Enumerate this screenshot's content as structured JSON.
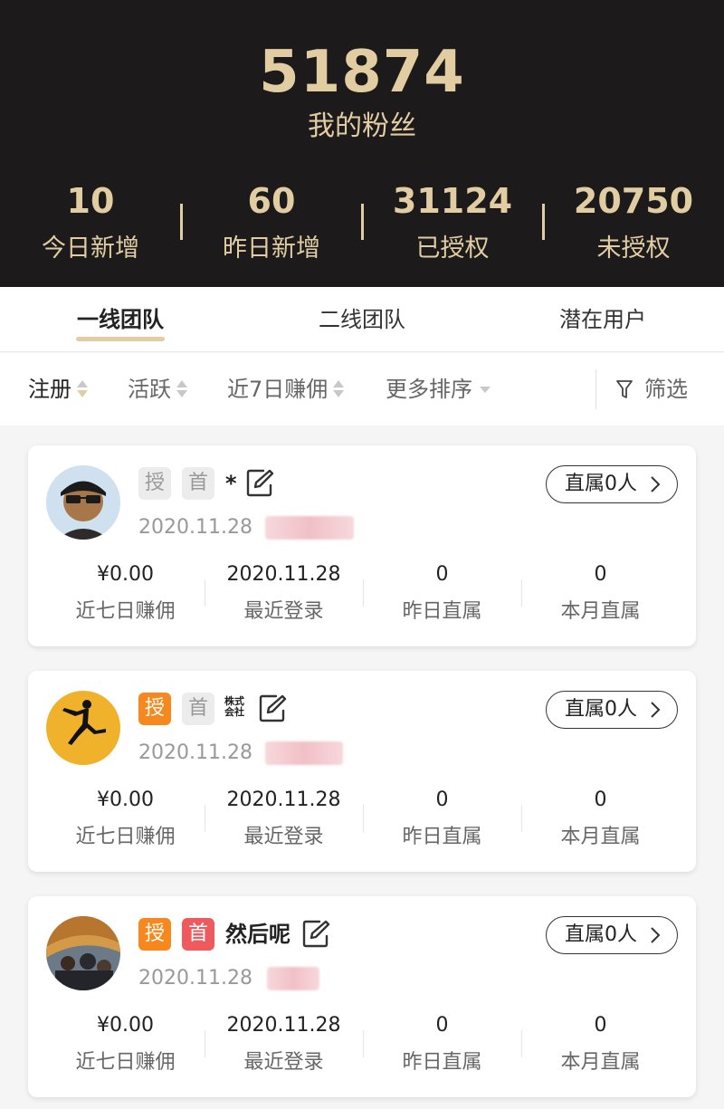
{
  "header": {
    "total_fans": "51874",
    "total_label": "我的粉丝",
    "stats": [
      {
        "value": "10",
        "label": "今日新增"
      },
      {
        "value": "60",
        "label": "昨日新增"
      },
      {
        "value": "31124",
        "label": "已授权"
      },
      {
        "value": "20750",
        "label": "未授权"
      }
    ]
  },
  "tabs": [
    {
      "label": "一线团队",
      "active": true
    },
    {
      "label": "二线团队",
      "active": false
    },
    {
      "label": "潜在用户",
      "active": false
    }
  ],
  "filters": {
    "register": "注册",
    "active": "活跃",
    "commission7": "近7日赚佣",
    "more_sort": "更多排序",
    "filter": "筛选"
  },
  "colors": {
    "header_bg": "#1c1a1b",
    "gold": "#e2cda3",
    "tag_orange": "#f7881d",
    "tag_red": "#ef5a5e"
  },
  "cards": [
    {
      "tag_auth": "授",
      "tag_first": "首",
      "nickname": "*",
      "date": "2020.11.28",
      "button": "直属0人",
      "metrics": [
        {
          "value": "¥0.00",
          "label": "近七日赚佣"
        },
        {
          "value": "2020.11.28",
          "label": "最近登录"
        },
        {
          "value": "0",
          "label": "昨日直属"
        },
        {
          "value": "0",
          "label": "本月直属"
        }
      ]
    },
    {
      "tag_auth": "授",
      "tag_first": "首",
      "nickname": "株式会社",
      "date": "2020.11.28",
      "button": "直属0人",
      "metrics": [
        {
          "value": "¥0.00",
          "label": "近七日赚佣"
        },
        {
          "value": "2020.11.28",
          "label": "最近登录"
        },
        {
          "value": "0",
          "label": "昨日直属"
        },
        {
          "value": "0",
          "label": "本月直属"
        }
      ]
    },
    {
      "tag_auth": "授",
      "tag_first": "首",
      "nickname": "然后呢",
      "date": "2020.11.28",
      "button": "直属0人",
      "metrics": [
        {
          "value": "¥0.00",
          "label": "近七日赚佣"
        },
        {
          "value": "2020.11.28",
          "label": "最近登录"
        },
        {
          "value": "0",
          "label": "昨日直属"
        },
        {
          "value": "0",
          "label": "本月直属"
        }
      ]
    }
  ]
}
